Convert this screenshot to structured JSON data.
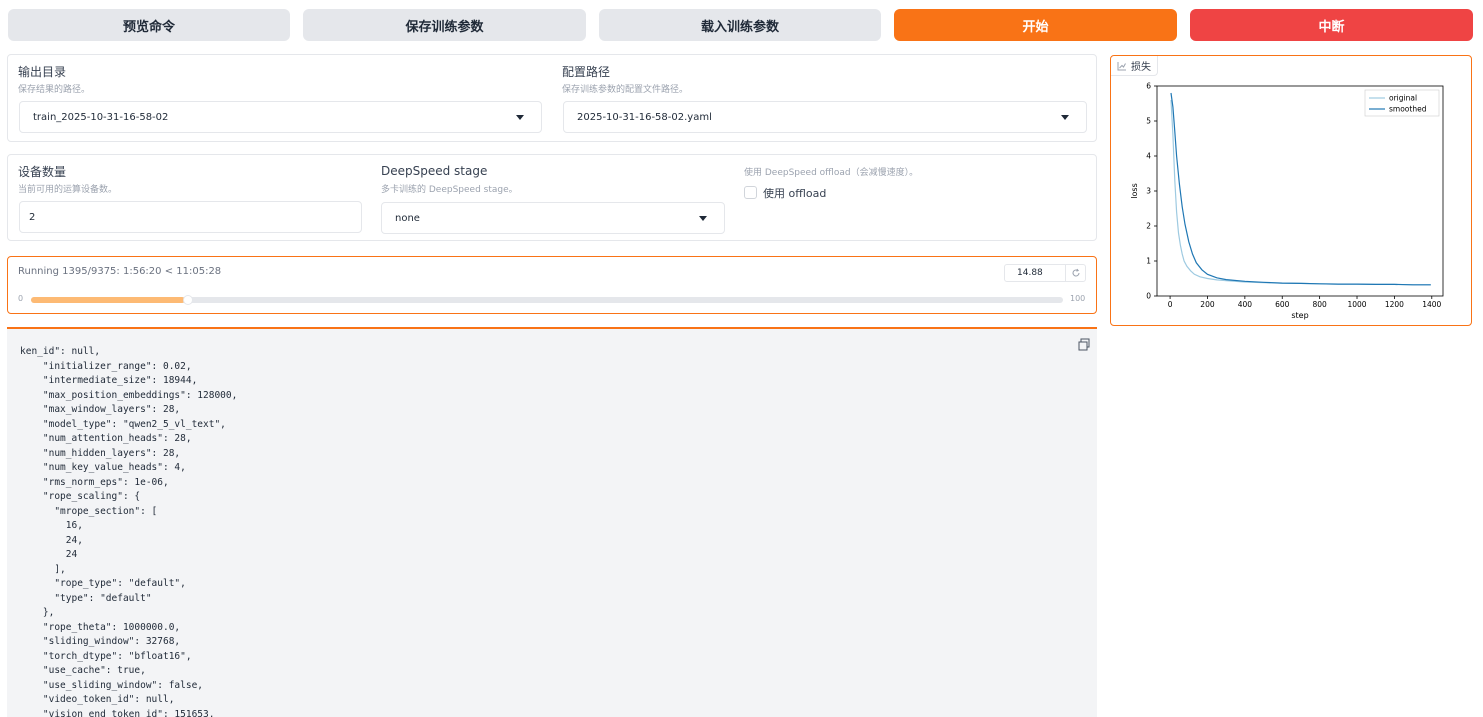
{
  "toolbar": {
    "preview_label": "预览命令",
    "save_label": "保存训练参数",
    "load_label": "载入训练参数",
    "start_label": "开始",
    "abort_label": "中断"
  },
  "output_dir": {
    "label": "输出目录",
    "info": "保存结果的路径。",
    "value": "train_2025-10-31-16-58-02"
  },
  "config_path": {
    "label": "配置路径",
    "info": "保存训练参数的配置文件路径。",
    "value": "2025-10-31-16-58-02.yaml"
  },
  "device_count": {
    "label": "设备数量",
    "info": "当前可用的运算设备数。",
    "value": "2"
  },
  "ds_stage": {
    "label": "DeepSpeed stage",
    "info": "多卡训练的 DeepSpeed stage。",
    "value": "none"
  },
  "ds_offload": {
    "info": "使用 DeepSpeed offload（会减慢速度）。",
    "label": "使用 offload",
    "checked": false
  },
  "progress": {
    "status": "Running 1395/9375: 1:56:20 < 11:05:28",
    "value": "14.88",
    "fraction": 0.1488,
    "min_label": "0",
    "max_label": "100"
  },
  "output_box": {
    "lines": [
      "ken_id\": null,",
      "    \"initializer_range\": 0.02,",
      "    \"intermediate_size\": 18944,",
      "    \"max_position_embeddings\": 128000,",
      "    \"max_window_layers\": 28,",
      "    \"model_type\": \"qwen2_5_vl_text\",",
      "    \"num_attention_heads\": 28,",
      "    \"num_hidden_layers\": 28,",
      "    \"num_key_value_heads\": 4,",
      "    \"rms_norm_eps\": 1e-06,",
      "    \"rope_scaling\": {",
      "      \"mrope_section\": [",
      "        16,",
      "        24,",
      "        24",
      "      ],",
      "      \"rope_type\": \"default\",",
      "      \"type\": \"default\"",
      "    },",
      "    \"rope_theta\": 1000000.0,",
      "    \"sliding_window\": 32768,",
      "    \"torch_dtype\": \"bfloat16\",",
      "    \"use_cache\": true,",
      "    \"use_sliding_window\": false,",
      "    \"video_token_id\": null,",
      "    \"vision_end_token_id\": 151653,"
    ]
  },
  "loss_plot": {
    "label": "损失",
    "icon": "chart-icon"
  },
  "chart_data": {
    "type": "line",
    "xlabel": "step",
    "ylabel": "loss",
    "xlim": [
      -70,
      1460
    ],
    "ylim": [
      0,
      6
    ],
    "xticks": [
      0,
      200,
      400,
      600,
      800,
      1000,
      1200,
      1400
    ],
    "yticks": [
      0,
      1,
      2,
      3,
      4,
      5,
      6
    ],
    "legend_position": "top-right",
    "grid": false,
    "series": [
      {
        "name": "original",
        "color": "#9ecae1",
        "x": [
          5,
          15,
          25,
          35,
          45,
          55,
          65,
          75,
          90,
          110,
          130,
          160,
          200,
          250,
          300,
          400,
          500,
          600,
          700,
          800,
          900,
          1000,
          1100,
          1200,
          1300,
          1395
        ],
        "y": [
          5.6,
          4.6,
          3.3,
          2.4,
          1.8,
          1.45,
          1.2,
          1.0,
          0.85,
          0.72,
          0.62,
          0.55,
          0.5,
          0.46,
          0.44,
          0.4,
          0.38,
          0.37,
          0.36,
          0.35,
          0.34,
          0.34,
          0.33,
          0.33,
          0.32,
          0.32
        ]
      },
      {
        "name": "smoothed",
        "color": "#1f77b4",
        "x": [
          5,
          15,
          25,
          35,
          50,
          65,
          80,
          100,
          120,
          140,
          170,
          200,
          250,
          300,
          400,
          500,
          600,
          700,
          800,
          900,
          1000,
          1100,
          1200,
          1300,
          1395
        ],
        "y": [
          5.8,
          5.4,
          4.7,
          4.0,
          3.2,
          2.55,
          2.05,
          1.55,
          1.2,
          0.95,
          0.75,
          0.62,
          0.52,
          0.47,
          0.42,
          0.39,
          0.37,
          0.36,
          0.35,
          0.34,
          0.34,
          0.33,
          0.33,
          0.32,
          0.32
        ]
      }
    ]
  }
}
